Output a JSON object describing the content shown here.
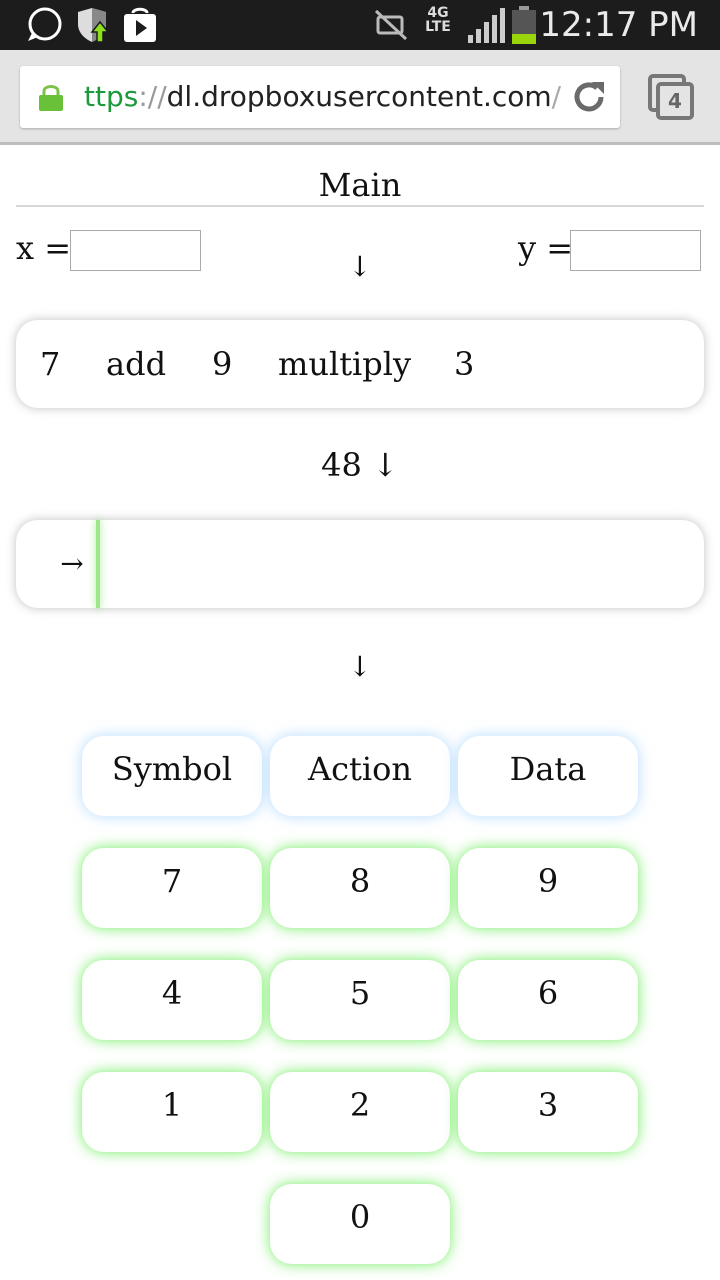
{
  "status_bar": {
    "time": "12:17 PM",
    "network": "4G LTE",
    "icons": [
      "chat-bubble-icon",
      "shield-update-icon",
      "play-store-icon",
      "mute-icon",
      "lte-icon",
      "signal-icon",
      "battery-icon"
    ]
  },
  "browser": {
    "url_scheme": "ttps",
    "url_sep": "://",
    "url_host": "dl.dropboxusercontent.com",
    "url_tail": "/u",
    "tab_count": "4"
  },
  "page": {
    "title": "Main",
    "x_label": "x =",
    "y_label": "y =",
    "x_value": "",
    "y_value": "",
    "arrow_down": "↓",
    "expression": [
      "7",
      "add",
      "9",
      "multiply",
      "3"
    ],
    "result": "48 ↓",
    "input_arrow": "→",
    "arrow_down_2": "↓"
  },
  "keypad": {
    "row0": [
      "Symbol",
      "Action",
      "Data"
    ],
    "row1": [
      "7",
      "8",
      "9"
    ],
    "row2": [
      "4",
      "5",
      "6"
    ],
    "row3": [
      "1",
      "2",
      "3"
    ],
    "row4": [
      "0"
    ]
  },
  "colors": {
    "accent_green": "#5aeb46",
    "accent_blue": "#78beff",
    "url_green": "#1a9a3a"
  }
}
